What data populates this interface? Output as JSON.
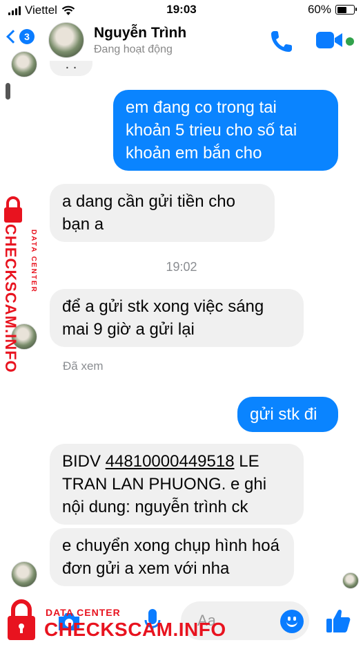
{
  "status_bar": {
    "carrier": "Viettel",
    "time": "19:03",
    "battery": "60%",
    "battery_level": 0.6
  },
  "header": {
    "back_badge": "3",
    "contact_name": "Nguyễn Trình",
    "contact_status": "Đang hoạt động",
    "icons": [
      "back-chevron-icon",
      "phone-icon",
      "video-camera-icon"
    ],
    "accent_color": "#0a7cff",
    "online_color": "#31a24c"
  },
  "conversation": {
    "typing_dots": ". .",
    "timestamp": "19:02",
    "seen_label": "Đã xem",
    "messages": [
      {
        "direction": "out",
        "text": "em đang co trong tai khoản 5 trieu cho số tai khoản em bắn cho"
      },
      {
        "direction": "in",
        "text": "a dang cần gửi tiền cho bạn a"
      },
      {
        "direction": "in",
        "text": "để a gửi stk xong việc sáng mai 9 giờ a gửi lại"
      },
      {
        "direction": "out",
        "text": "gửi stk đi"
      },
      {
        "direction": "in",
        "prefix": "BIDV ",
        "account": "44810000449518",
        "suffix": " LE TRAN LAN PHUONG. e ghi nội dung: nguyễn trình ck"
      },
      {
        "direction": "in",
        "text": "e chuyển xong chụp hình hoá đơn gửi a xem với nha"
      }
    ],
    "outgoing_color": "#0a84ff",
    "incoming_color": "#f0f0f0"
  },
  "composer": {
    "placeholder": "Aa",
    "icons": [
      "camera-icon",
      "microphone-icon",
      "emoji-icon",
      "thumbs-up-icon"
    ]
  },
  "watermark": {
    "side_small": "DATA CENTER",
    "side_big": "CHECKSCAM.INFO",
    "bottom_small": "DATA CENTER",
    "bottom_big": "CHECKSCAM.INFO",
    "color": "#e8131f"
  }
}
